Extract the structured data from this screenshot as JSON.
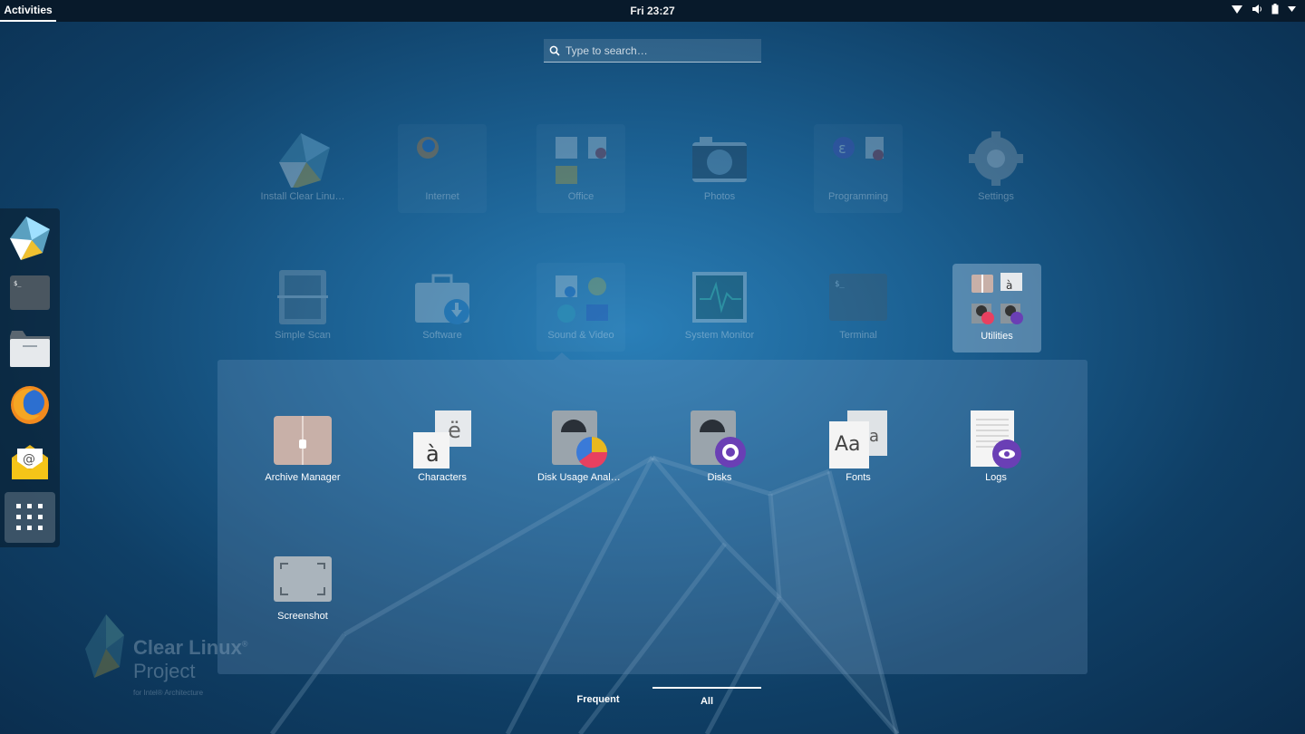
{
  "topbar": {
    "activities": "Activities",
    "clock": "Fri 23:27"
  },
  "search": {
    "placeholder": "Type to search…"
  },
  "dash": {
    "items": [
      {
        "name": "Install Clear Linux",
        "icon": "clear-linux-installer-icon"
      },
      {
        "name": "Terminal",
        "icon": "terminal-icon"
      },
      {
        "name": "Files",
        "icon": "files-icon"
      },
      {
        "name": "Firefox",
        "icon": "firefox-icon"
      },
      {
        "name": "Evolution",
        "icon": "mail-icon"
      },
      {
        "name": "Show Applications",
        "icon": "app-grid-icon"
      }
    ]
  },
  "grid": {
    "row1": [
      {
        "label": "Install Clear Linu…"
      },
      {
        "label": "Internet"
      },
      {
        "label": "Office"
      },
      {
        "label": "Photos"
      },
      {
        "label": "Programming"
      },
      {
        "label": "Settings"
      }
    ],
    "row2": [
      {
        "label": "Simple Scan"
      },
      {
        "label": "Software"
      },
      {
        "label": "Sound & Video"
      },
      {
        "label": "System Monitor"
      },
      {
        "label": "Terminal"
      },
      {
        "label": "Utilities"
      }
    ]
  },
  "utilities_folder": {
    "apps": [
      {
        "label": "Archive Manager"
      },
      {
        "label": "Characters"
      },
      {
        "label": "Disk Usage Analy…"
      },
      {
        "label": "Disks"
      },
      {
        "label": "Fonts"
      },
      {
        "label": "Logs"
      },
      {
        "label": "Screenshot"
      }
    ]
  },
  "tabs": {
    "frequent": "Frequent",
    "all": "All"
  },
  "branding": {
    "line1": "Clear Linux",
    "line1_mark": "®",
    "line2": "Project",
    "line3": "for Intel® Architecture"
  },
  "colors": {
    "accent_purple": "#6a3fb5",
    "topbar": "#081a2b",
    "background": "#1a5d8e"
  }
}
